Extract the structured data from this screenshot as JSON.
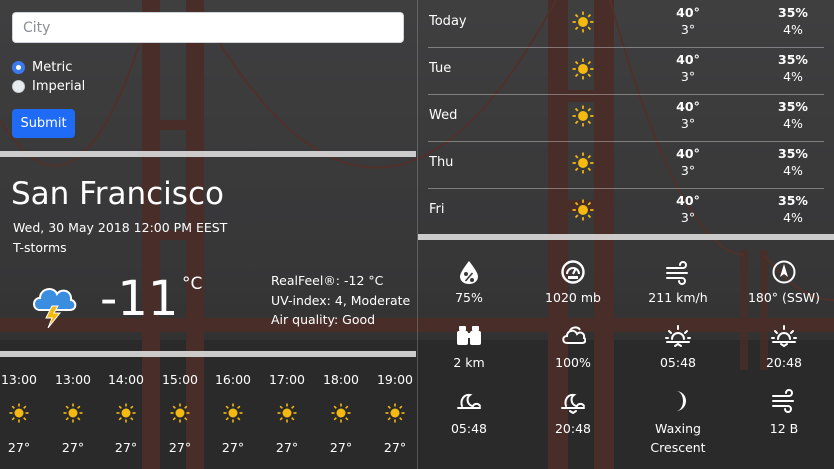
{
  "search": {
    "placeholder": "City"
  },
  "units": {
    "metric_label": "Metric",
    "imperial_label": "Imperial",
    "selected": "Metric"
  },
  "submit_label": "Submit",
  "current": {
    "city": "San Francisco",
    "datetime": "Wed, 30 May 2018 12:00 PM EEST",
    "condition": "T-storms",
    "temperature": "-11",
    "unit": "°C",
    "realfeel": "RealFeel®: -12 °C",
    "uv": "UV-index: 4, Moderate",
    "air": "Air quality: Good"
  },
  "hourly": [
    {
      "time": "13:00",
      "temp": "27°"
    },
    {
      "time": "13:00",
      "temp": "27°"
    },
    {
      "time": "14:00",
      "temp": "27°"
    },
    {
      "time": "15:00",
      "temp": "27°"
    },
    {
      "time": "16:00",
      "temp": "27°"
    },
    {
      "time": "17:00",
      "temp": "27°"
    },
    {
      "time": "18:00",
      "temp": "27°"
    },
    {
      "time": "19:00",
      "temp": "27°"
    }
  ],
  "daily": [
    {
      "day": "Today",
      "high": "40°",
      "low": "3°",
      "precip": "35%",
      "secondary": "4%"
    },
    {
      "day": "Tue",
      "high": "40°",
      "low": "3°",
      "precip": "35%",
      "secondary": "4%"
    },
    {
      "day": "Wed",
      "high": "40°",
      "low": "3°",
      "precip": "35%",
      "secondary": "4%"
    },
    {
      "day": "Thu",
      "high": "40°",
      "low": "3°",
      "precip": "35%",
      "secondary": "4%"
    },
    {
      "day": "Fri",
      "high": "40°",
      "low": "3°",
      "precip": "35%",
      "secondary": "4%"
    }
  ],
  "metrics": {
    "humidity": "75%",
    "pressure": "1020 mb",
    "wind_speed": "211 km/h",
    "wind_dir": "180° (SSW)",
    "visibility": "2 km",
    "cloud_cover": "100%",
    "sunrise": "05:48",
    "sunset": "20:48",
    "moonrise": "05:48",
    "moonset": "20:48",
    "moon_phase": [
      "Waxing",
      "Crescent"
    ],
    "wind_force": "12 B"
  },
  "colors": {
    "accent": "#1f6bf5",
    "sun": "#f5b90f",
    "cloud_icon": "#3b8de0",
    "bolt": "#f5b90f"
  }
}
